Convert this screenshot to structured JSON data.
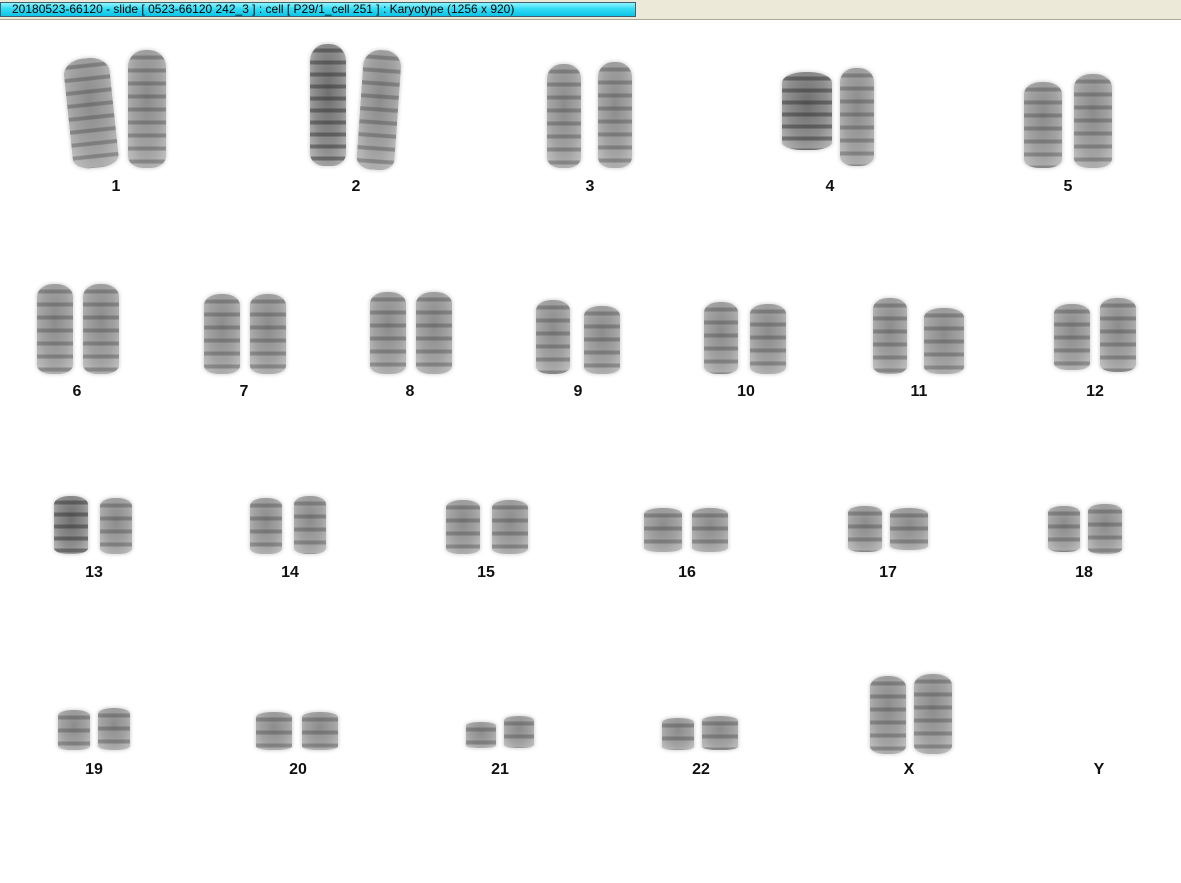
{
  "window": {
    "title": "20180523-66120 - slide [ 0523-66120 242_3 ] : cell [ P29/1_cell 251 ] : Karyotype  (1256 x 920)"
  },
  "karyotype": {
    "labels": {
      "c1": "1",
      "c2": "2",
      "c3": "3",
      "c4": "4",
      "c5": "5",
      "c6": "6",
      "c7": "7",
      "c8": "8",
      "c9": "9",
      "c10": "10",
      "c11": "11",
      "c12": "12",
      "c13": "13",
      "c14": "14",
      "c15": "15",
      "c16": "16",
      "c17": "17",
      "c18": "18",
      "c19": "19",
      "c20": "20",
      "c21": "21",
      "c22": "22",
      "cX": "X",
      "cY": "Y"
    }
  }
}
